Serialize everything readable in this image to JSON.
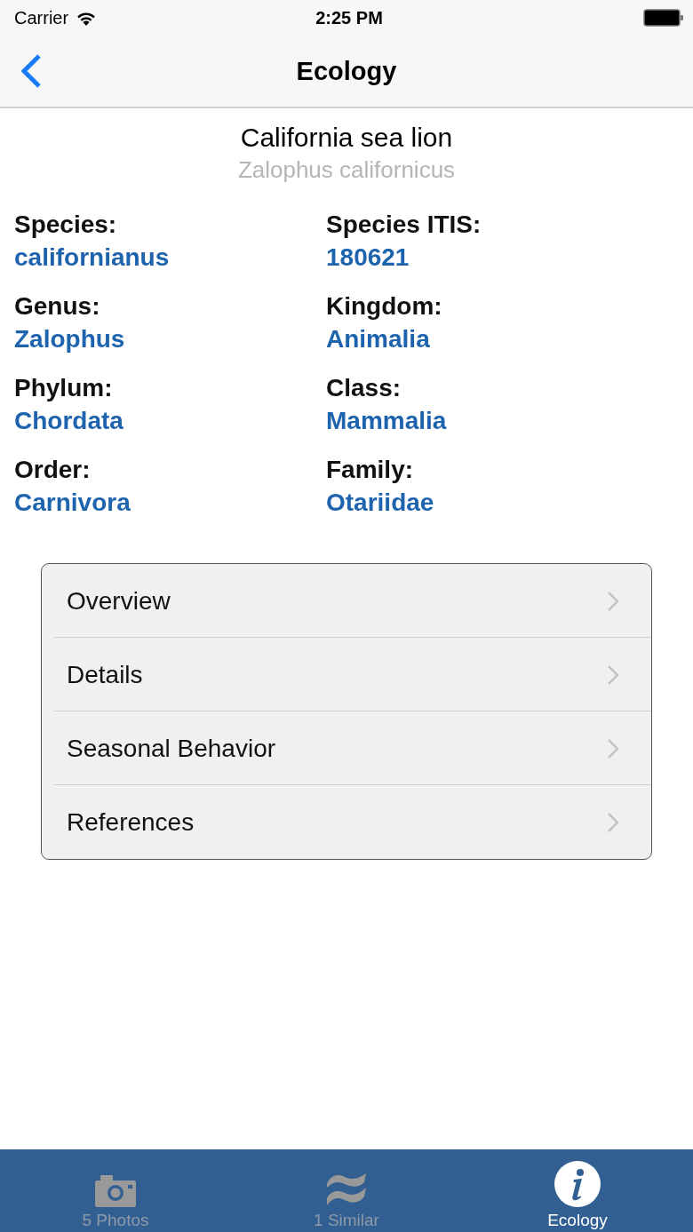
{
  "status_bar": {
    "carrier": "Carrier",
    "time": "2:25 PM"
  },
  "nav_bar": {
    "title": "Ecology"
  },
  "header": {
    "common_name": "California sea lion",
    "scientific_name": "Zalophus californicus"
  },
  "taxonomy": [
    {
      "label": "Species:",
      "value": "californianus"
    },
    {
      "label": "Species ITIS:",
      "value": "180621"
    },
    {
      "label": "Genus:",
      "value": "Zalophus"
    },
    {
      "label": "Kingdom:",
      "value": "Animalia"
    },
    {
      "label": "Phylum:",
      "value": "Chordata"
    },
    {
      "label": "Class:",
      "value": "Mammalia"
    },
    {
      "label": "Order:",
      "value": "Carnivora"
    },
    {
      "label": "Family:",
      "value": "Otariidae"
    }
  ],
  "sections": [
    {
      "label": "Overview"
    },
    {
      "label": "Details"
    },
    {
      "label": "Seasonal Behavior"
    },
    {
      "label": "References"
    }
  ],
  "tab_bar": [
    {
      "label": "5 Photos",
      "selected": false
    },
    {
      "label": "1 Similar",
      "selected": false
    },
    {
      "label": "Ecology",
      "selected": true
    }
  ]
}
